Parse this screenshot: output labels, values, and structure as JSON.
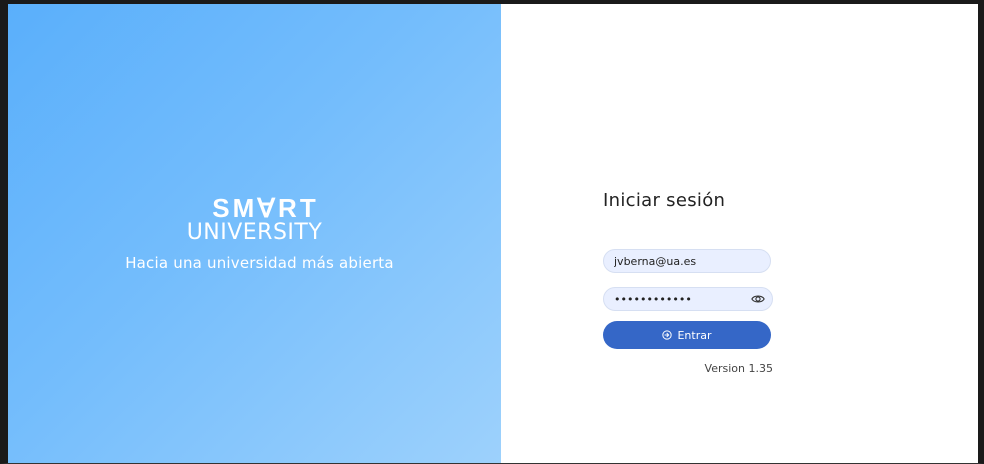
{
  "brand": {
    "logo_line1": "SMⱯRT",
    "logo_line2": "UNIVERSITY",
    "tagline": "Hacia una universidad más abierta"
  },
  "login": {
    "title": "Iniciar sesión",
    "email_value": "jvberna@ua.es",
    "password_value": "••••••••••••",
    "show_password_icon": "eye-icon",
    "submit_label": "Entrar",
    "submit_icon": "enter-icon",
    "version": "Version 1.35"
  },
  "colors": {
    "panel_gradient_start": "#5aaffb",
    "panel_gradient_end": "#9dd1fc",
    "button": "#3567c7",
    "input_bg": "#e9efff"
  }
}
